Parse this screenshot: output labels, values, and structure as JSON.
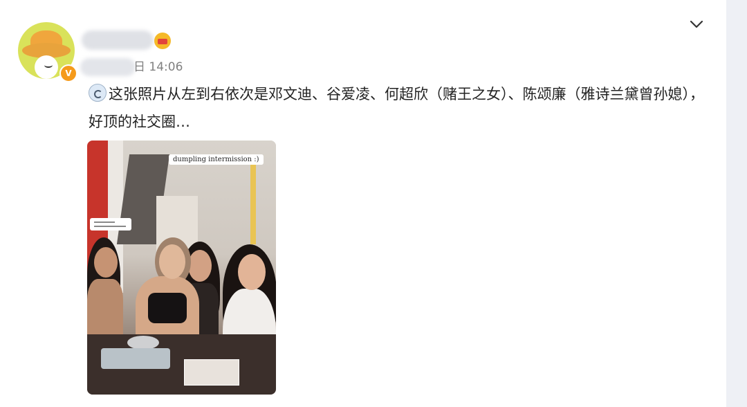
{
  "post": {
    "time": "日 14:06",
    "text": "这张照片从左到右依次是邓文迪、谷爱凌、何超欣（赌王之女）、陈颂廉（雅诗兰黛曾孙媳），好顶的社交圈…",
    "verified_badge": "V",
    "emoji_icon": "thinking-emoji-icon",
    "photo_caption": "dumpling intermission :)"
  },
  "icons": {
    "menu": "chevron-down-icon",
    "crown": "crown-badge-icon"
  },
  "colors": {
    "accent": "#f59a1b",
    "text": "#222222",
    "meta": "#808080"
  }
}
